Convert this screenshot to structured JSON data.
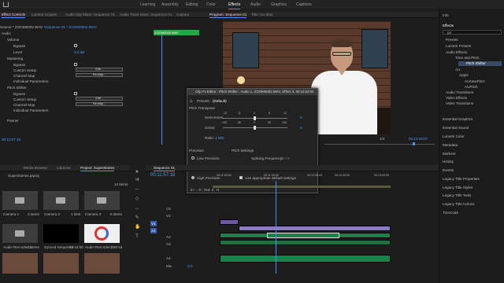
{
  "workspaces": [
    "Learning",
    "Assembly",
    "Editing",
    "Color",
    "Effects",
    "Audio",
    "Graphics",
    "Captions"
  ],
  "active_workspace": "Effects",
  "effect_controls": {
    "tabs": [
      "Effect Controls",
      "Lumetri Scopes",
      "Audio Clip Mixer: Sequence 01",
      "Audio Track Mixer: Sequence 01",
      "Capture"
    ],
    "source": "Source * ZOOM0002.WAV",
    "sequence": "Sequence 01 * ZOOM0002.WAV",
    "clip_label": "ZOOM0002.WAV",
    "rows": [
      "Audio",
      "Volume",
      "Bypass",
      "Level",
      "Mastering",
      "Bypass",
      "Custom Setup",
      "Channel Map",
      "Individual Parameters",
      "Pitch Shifter",
      "Bypass",
      "Custom Setup",
      "Channel Map",
      "Individual Parameters",
      "Panner"
    ],
    "level_value": "0.0 dB",
    "edit_btn": "Edit...",
    "remap_btn": "Re-map...",
    "timecode": "00:11:57:18"
  },
  "program": {
    "tab": "Program: Sequence 01",
    "title_tab": "Title: (no title)",
    "fraction": "1/4",
    "timecode": "00:13:16:07"
  },
  "clip_fx": {
    "title": "Clip Fx Editor - Pitch Shifter : Audio 1, ZOOM0002.WAV, Effect 3, 00:11:52:04",
    "presets_label": "Presets:",
    "preset_value": "(Default)",
    "pitch_transpose": "Pitch Transpose",
    "semitones_label": "Semi-tones",
    "semitones_ticks": [
      "-12",
      "-6",
      "0",
      "6",
      "12"
    ],
    "semitones_value": "0",
    "cents_label": "Cents:",
    "cents_ticks": [
      "-100",
      "-50",
      "0",
      "50",
      "100"
    ],
    "cents_value": "0",
    "ratio_label": "Ratio:",
    "ratio_value": "1.000",
    "precision_label": "Precision",
    "precisions": [
      "Low Precision",
      "Medium Precision",
      "High Precision"
    ],
    "precision_selected": "High Precision",
    "pitch_settings": "Pitch Settings",
    "splicing": "Splicing Frequency:",
    "splicing_value": "30 Hz",
    "overlapping": "Overlapping:",
    "overlapping_value": "20 %",
    "use_default": "Use appropriate default settings",
    "io_text": "In: -, 0 ; Out: 0, -0"
  },
  "project": {
    "tabs": [
      "Media Browser",
      "Libraries",
      "Project: SuperStories"
    ],
    "filename": "SuperStories.prproj",
    "items_count": "14 items",
    "items": [
      {
        "name": "Camera 1",
        "meta": "3 items"
      },
      {
        "name": "Camera 2",
        "meta": "1 item"
      },
      {
        "name": "Camera 3",
        "meta": "6 items"
      },
      {
        "name": "Audio Recorder 1",
        "meta": "3 items"
      },
      {
        "name": "Synced Sequence",
        "meta": "22:44:00"
      },
      {
        "name": "Audio Recorder 2",
        "meta": "1:59:15"
      }
    ]
  },
  "timeline": {
    "tab": "Sequence 01",
    "timecode": "00:11:57:18",
    "ruler": [
      "00:11:00:00",
      "00:11:30:00",
      "00:12:00:00",
      "00:12:30:00",
      "00:13:00:00"
    ],
    "tracks": [
      "V3",
      "V2",
      "V1",
      "A1",
      "A2",
      "A3",
      "A4",
      "Mix"
    ],
    "mix_value": "0.0"
  },
  "right_panel": {
    "info": "Info",
    "effects": "Effects",
    "search": "pit",
    "tree": [
      "Presets",
      "Lumetri Presets",
      "Audio Effects",
      "Time and Pitch",
      "Pitch Shifter",
      "AU",
      "Apple",
      "AUNewPitch",
      "AUPitch",
      "Audio Transitions",
      "Video Effects",
      "Video Transitions"
    ],
    "panels": [
      "Essential Graphics",
      "Essential Sound",
      "Lumetri Color",
      "Metadata",
      "Markers",
      "History",
      "Events",
      "Legacy Title Properties",
      "Legacy Title Styles",
      "Legacy Title Tools",
      "Legacy Title Actions",
      "Timecode"
    ]
  },
  "colors": {
    "accent": "#4d8cf5",
    "audio_clip": "#1d7f49",
    "video_clip": "#6d58a3",
    "clip_label": "#27a843"
  }
}
